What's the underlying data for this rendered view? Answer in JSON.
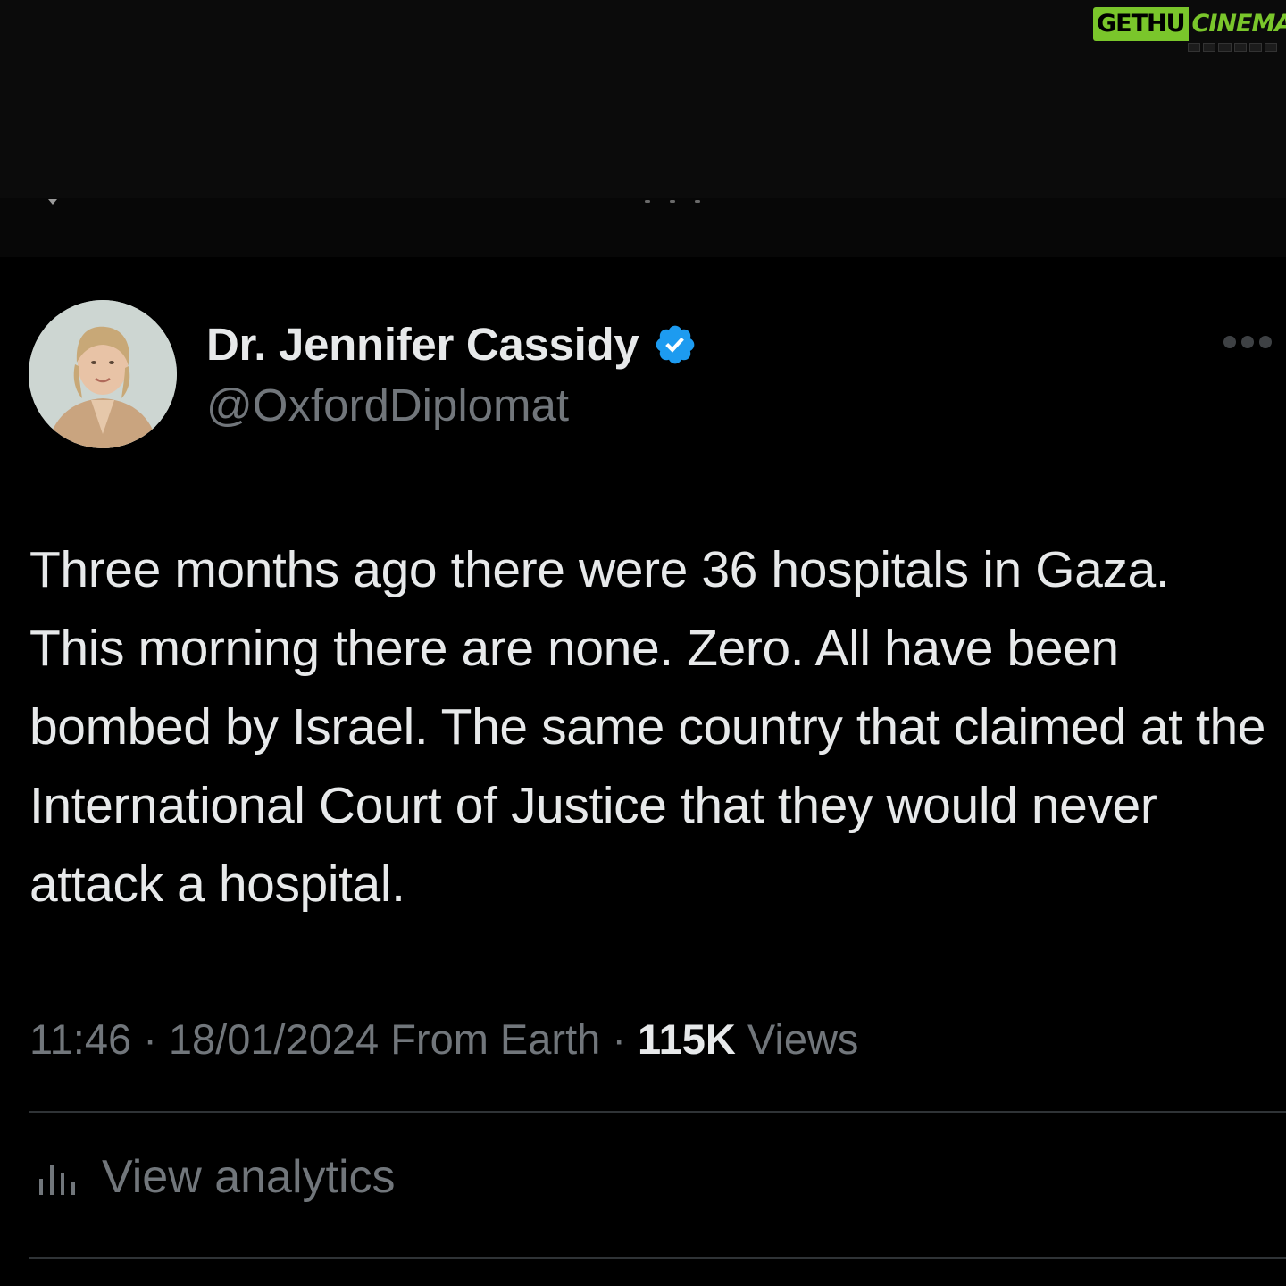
{
  "watermark": {
    "left_text": "GETHU",
    "right_text": "CINEMA"
  },
  "tweet": {
    "author": {
      "display_name": "Dr. Jennifer Cassidy",
      "handle": "@OxfordDiplomat",
      "verified": true
    },
    "text": "Three months ago there were 36 hospitals in Gaza. This morning there are none. Zero. All have been bombed by Israel. The same country that claimed at the International Court of Justice that they would never attack a hospital.",
    "time": "11:46",
    "separator": "·",
    "date": "18/01/2024",
    "source": "From Earth",
    "views_count": "115K",
    "views_label": "Views",
    "analytics_label": "View analytics"
  },
  "icons": {
    "verified": "verified-badge-icon",
    "more": "more-options-icon",
    "analytics": "analytics-bars-icon"
  },
  "colors": {
    "background": "#000000",
    "primary_text": "#e7e9ea",
    "secondary_text": "#71767b",
    "verified_blue": "#1d9bf0",
    "divider": "#2f3336",
    "watermark_green": "#7ac62b"
  }
}
